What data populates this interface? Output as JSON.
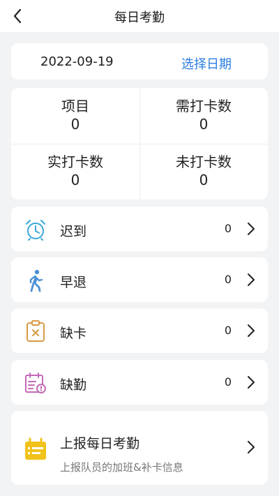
{
  "header": {
    "title": "每日考勤",
    "back_icon": "chevron-left-icon"
  },
  "date": {
    "value": "2022-09-19",
    "pick_label": "选择日期",
    "pick_color": "#2b7de1"
  },
  "stats": [
    {
      "label": "项目",
      "value": "0"
    },
    {
      "label": "需打卡数",
      "value": "0"
    },
    {
      "label": "实打卡数",
      "value": "0"
    },
    {
      "label": "未打卡数",
      "value": "0"
    }
  ],
  "items": [
    {
      "label": "迟到",
      "count": "0",
      "icon": "alarm-clock-icon",
      "color": "#3aa7d8"
    },
    {
      "label": "早退",
      "count": "0",
      "icon": "walking-person-icon",
      "color": "#4a8fd6"
    },
    {
      "label": "缺卡",
      "count": "0",
      "icon": "clipboard-x-icon",
      "color": "#d79a43"
    },
    {
      "label": "缺勤",
      "count": "0",
      "icon": "calendar-alert-icon",
      "color": "#c46ab8"
    }
  ],
  "report": {
    "title": "上报每日考勤",
    "subtitle": "上报队员的加班&补卡信息",
    "icon": "calendar-report-icon",
    "color": "#f0c21a"
  }
}
